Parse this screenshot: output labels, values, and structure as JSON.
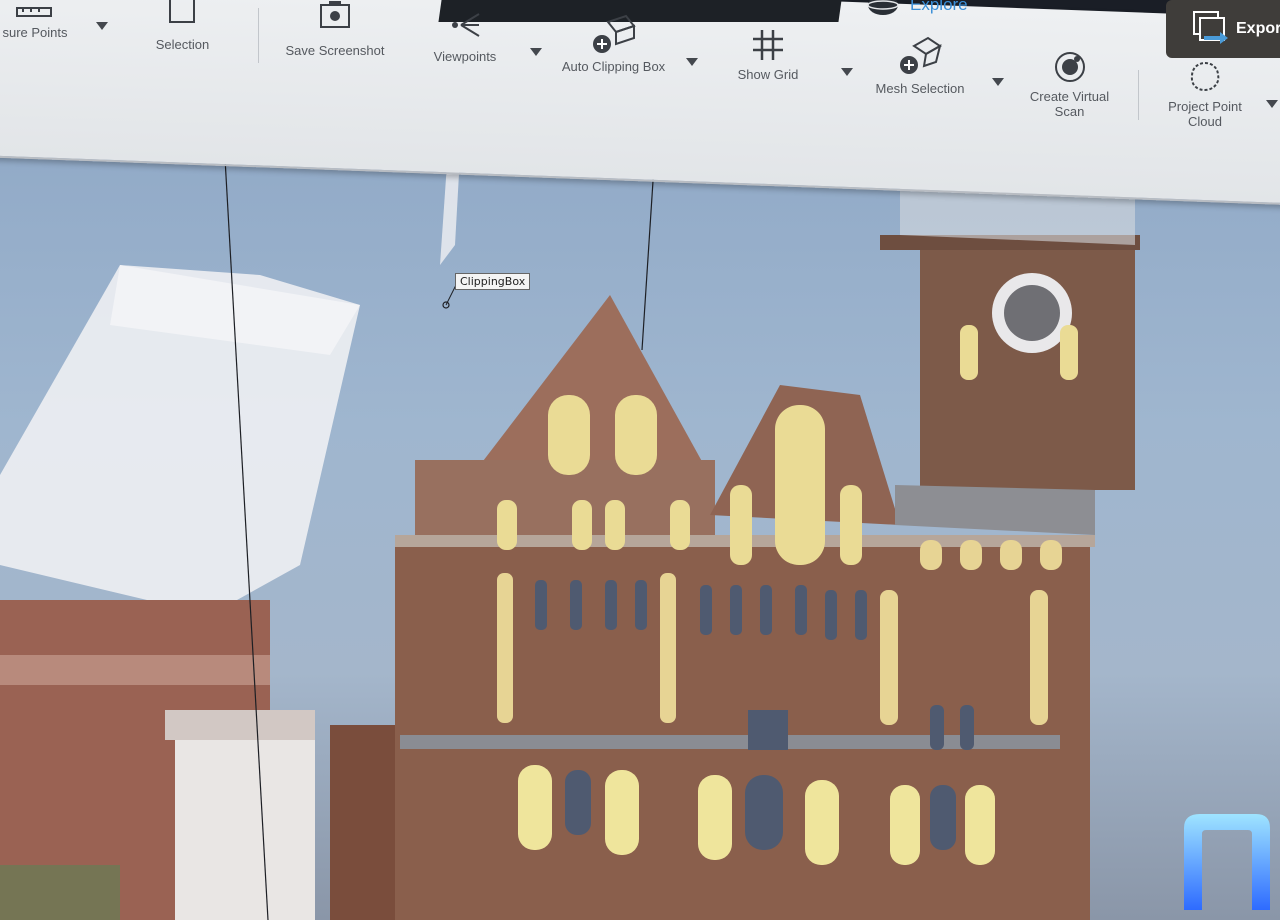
{
  "ribbon": {
    "tools": [
      {
        "id": "measure-points",
        "label": "sure Points",
        "icon": "ruler-icon",
        "has_dropdown": true
      },
      {
        "id": "selection",
        "label": "Selection",
        "icon": "selection-icon",
        "has_dropdown": false
      },
      {
        "id": "save-screenshot",
        "label": "Save Screenshot",
        "icon": "camera-icon",
        "has_dropdown": false
      },
      {
        "id": "viewpoints",
        "label": "Viewpoints",
        "icon": "viewpoint-icon",
        "has_dropdown": true
      },
      {
        "id": "auto-clipping-box",
        "label": "Auto Clipping Box",
        "icon": "clipping-box-icon",
        "has_dropdown": true
      },
      {
        "id": "show-grid",
        "label": "Show Grid",
        "icon": "grid-icon",
        "has_dropdown": true
      },
      {
        "id": "mesh-selection",
        "label": "Mesh Selection",
        "icon": "mesh-selection-icon",
        "has_dropdown": true
      },
      {
        "id": "create-virtual-scan",
        "label": "Create Virtual Scan",
        "icon": "virtual-scan-icon",
        "has_dropdown": false
      },
      {
        "id": "project-point-cloud",
        "label": "Project Point Cloud",
        "icon": "point-cloud-icon",
        "has_dropdown": true
      }
    ],
    "tabs": {
      "explore_label": "Explore",
      "export_label": "Expor"
    }
  },
  "viewport": {
    "clipping_box_label": "ClippingBox"
  },
  "colors": {
    "accent": "#3a8fd8",
    "ribbon_bg": "#e6e8eb",
    "sky": "#9db4cf",
    "brick": "#8a5f4c"
  }
}
